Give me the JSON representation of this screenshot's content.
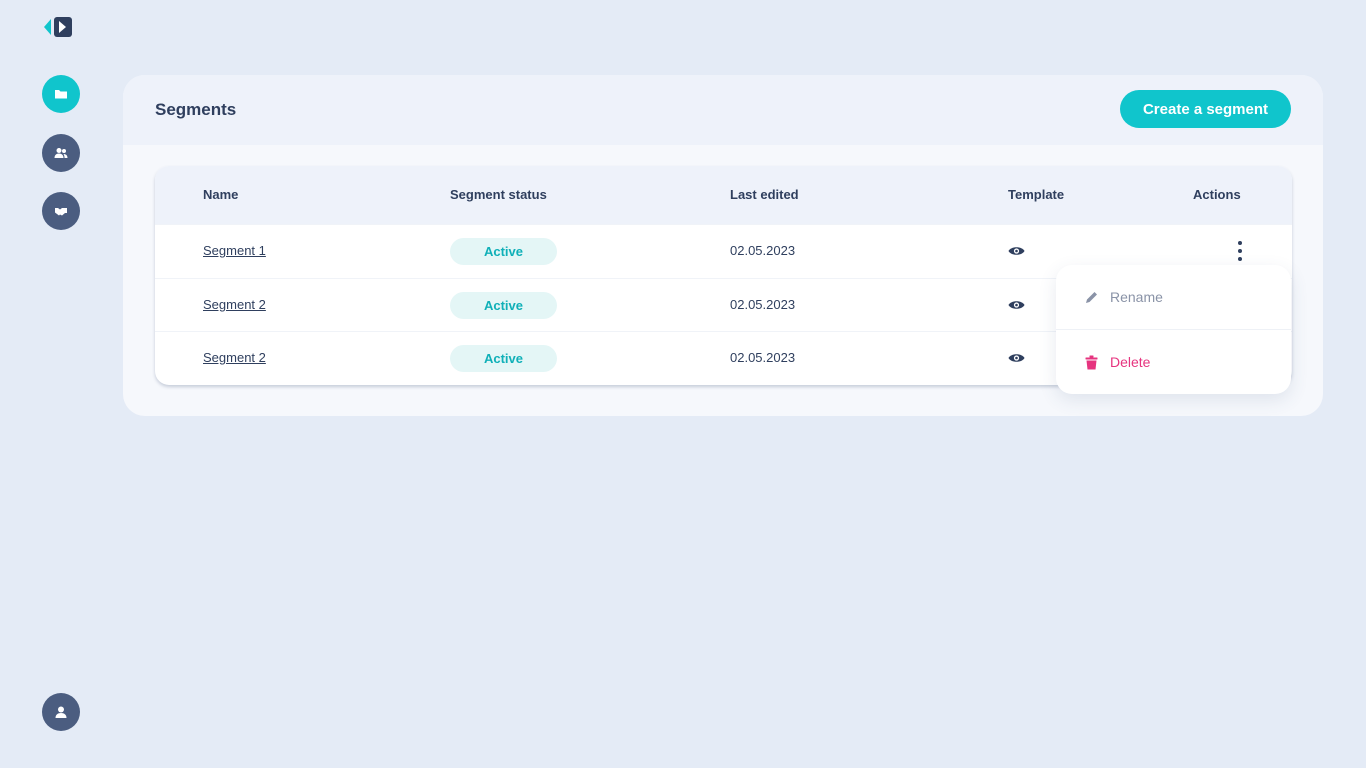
{
  "app": {
    "logo_icon": "brand-logo-icon",
    "accent_color": "#10c5cc"
  },
  "sidebar": {
    "items": [
      {
        "icon": "folder-icon",
        "active": true
      },
      {
        "icon": "users-icon",
        "active": false
      },
      {
        "icon": "handshake-icon",
        "active": false
      }
    ],
    "profile_icon": "user-icon"
  },
  "header": {
    "title": "Segments",
    "create_button_label": "Create a segment"
  },
  "table": {
    "columns": [
      "Name",
      "Segment status",
      "Last edited",
      "Template",
      "Actions"
    ],
    "rows": [
      {
        "name": "Segment 1",
        "status": "Active",
        "last_edited": "02.05.2023"
      },
      {
        "name": "Segment 2",
        "status": "Active",
        "last_edited": "02.05.2023"
      },
      {
        "name": "Segment 2",
        "status": "Active",
        "last_edited": "02.05.2023"
      }
    ]
  },
  "actions_menu": {
    "rename_label": "Rename",
    "delete_label": "Delete",
    "delete_color": "#e6347f"
  }
}
